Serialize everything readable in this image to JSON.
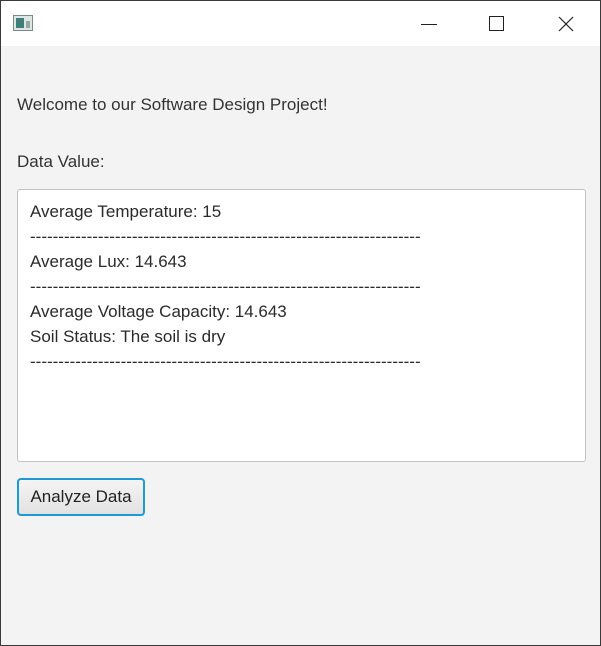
{
  "window": {
    "icon": "java-app-icon",
    "controls": {
      "minimize_icon": "minimize-icon",
      "maximize_icon": "maximize-icon",
      "close_icon": "close-icon"
    }
  },
  "main": {
    "welcome_text": "Welcome to our Software Design Project!",
    "data_label": "Data Value:",
    "data_lines": [
      "Average Temperature: 15",
      "---------------------------------------------------------------------",
      "Average Lux: 14.643",
      "---------------------------------------------------------------------",
      "Average Voltage Capacity: 14.643",
      "Soil Status: The soil is dry",
      "---------------------------------------------------------------------"
    ],
    "analyze_button_label": "Analyze Data"
  },
  "colors": {
    "window_background": "#f3f3f3",
    "focus_border": "#1c9ad6"
  }
}
